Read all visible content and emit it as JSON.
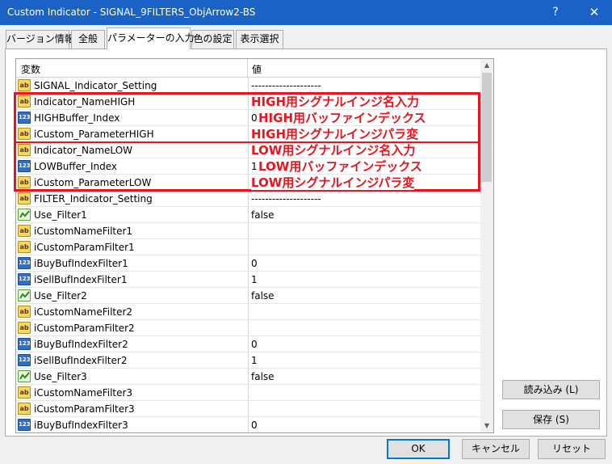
{
  "window": {
    "title": "Custom Indicator - SIGNAL_9FILTERS_ObjArrow2-BS",
    "help_label": "?",
    "close_label": "✕"
  },
  "tabs": [
    {
      "label": "バージョン情報"
    },
    {
      "label": "全般"
    },
    {
      "label": "パラメーターの入力"
    },
    {
      "label": "色の設定"
    },
    {
      "label": "表示選択"
    }
  ],
  "grid": {
    "col_variable": "変数",
    "col_value": "値",
    "rows": [
      {
        "icon": "ab",
        "name": "SIGNAL_Indicator_Setting",
        "value": "--------------------"
      },
      {
        "icon": "ab",
        "name": "Indicator_NameHIGH",
        "value": ""
      },
      {
        "icon": "123",
        "name": "HIGHBuffer_Index",
        "value": "0"
      },
      {
        "icon": "ab",
        "name": "iCustom_ParameterHIGH",
        "value": ""
      },
      {
        "icon": "ab",
        "name": "Indicator_NameLOW",
        "value": ""
      },
      {
        "icon": "123",
        "name": "LOWBuffer_Index",
        "value": "1"
      },
      {
        "icon": "ab",
        "name": "iCustom_ParameterLOW",
        "value": ""
      },
      {
        "icon": "ab",
        "name": "FILTER_Indicator_Setting",
        "value": "--------------------"
      },
      {
        "icon": "bool",
        "name": "Use_Filter1",
        "value": "false"
      },
      {
        "icon": "ab",
        "name": "iCustomNameFilter1",
        "value": ""
      },
      {
        "icon": "ab",
        "name": "iCustomParamFilter1",
        "value": ""
      },
      {
        "icon": "123",
        "name": "iBuyBufIndexFilter1",
        "value": "0"
      },
      {
        "icon": "123",
        "name": "iSellBufIndexFilter1",
        "value": "1"
      },
      {
        "icon": "bool",
        "name": "Use_Filter2",
        "value": "false"
      },
      {
        "icon": "ab",
        "name": "iCustomNameFilter2",
        "value": ""
      },
      {
        "icon": "ab",
        "name": "iCustomParamFilter2",
        "value": ""
      },
      {
        "icon": "123",
        "name": "iBuyBufIndexFilter2",
        "value": "0"
      },
      {
        "icon": "123",
        "name": "iSellBufIndexFilter2",
        "value": "1"
      },
      {
        "icon": "bool",
        "name": "Use_Filter3",
        "value": "false"
      },
      {
        "icon": "ab",
        "name": "iCustomNameFilter3",
        "value": ""
      },
      {
        "icon": "ab",
        "name": "iCustomParamFilter3",
        "value": ""
      },
      {
        "icon": "123",
        "name": "iBuyBufIndexFilter3",
        "value": "0"
      }
    ]
  },
  "icon_labels": {
    "ab": "ab",
    "123": "123"
  },
  "annotations": {
    "color": "#e8141f",
    "high_name": "HIGH用シグナルインジ名入力",
    "high_buffer": "HIGH用バッファインデックス",
    "high_param": "HIGH用シグナルインジパラ変",
    "low_name": "LOW用シグナルインジ名入力",
    "low_buffer": "LOW用バッファインデックス",
    "low_param": "LOW用シグナルインジパラ変"
  },
  "buttons": {
    "load": "読み込み (L)",
    "save": "保存 (S)",
    "ok": "OK",
    "cancel": "キャンセル",
    "reset": "リセット"
  },
  "colors": {
    "titlebar": "#1a62c6",
    "accent": "#0078d7"
  }
}
